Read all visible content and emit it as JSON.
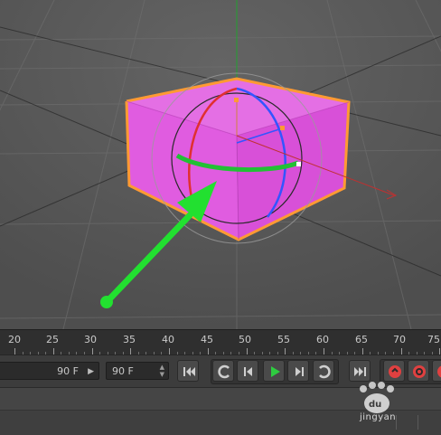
{
  "viewport": {
    "object": "cube",
    "object_color": "#e060e0",
    "selection_color": "#ff9a33",
    "axis_colors": {
      "x": "#e03030",
      "y": "#22c035",
      "z": "#3355ff"
    },
    "annotation": {
      "type": "arrow",
      "color": "#22e030"
    }
  },
  "timeline": {
    "ticks": [
      "20",
      "25",
      "30",
      "35",
      "40",
      "45",
      "50",
      "55",
      "60",
      "65",
      "70",
      "75"
    ]
  },
  "controls": {
    "end_frame_value": "90 F",
    "max_frame_value": "90 F",
    "buttons": [
      {
        "name": "go-to-start",
        "icon": "skip-start-icon"
      },
      {
        "name": "previous-key",
        "icon": "prev-key-icon"
      },
      {
        "name": "previous-frame",
        "icon": "step-back-icon"
      },
      {
        "name": "play",
        "icon": "play-icon",
        "color": "#2ecc40"
      },
      {
        "name": "next-frame",
        "icon": "step-forward-icon"
      },
      {
        "name": "next-key",
        "icon": "next-key-icon"
      },
      {
        "name": "go-to-end",
        "icon": "skip-end-icon"
      },
      {
        "name": "record",
        "icon": "record-key-icon",
        "color": "#e04040"
      },
      {
        "name": "autokey",
        "icon": "autokey-icon",
        "color": "#e04040"
      }
    ]
  },
  "watermark": {
    "text": "jingyan"
  }
}
